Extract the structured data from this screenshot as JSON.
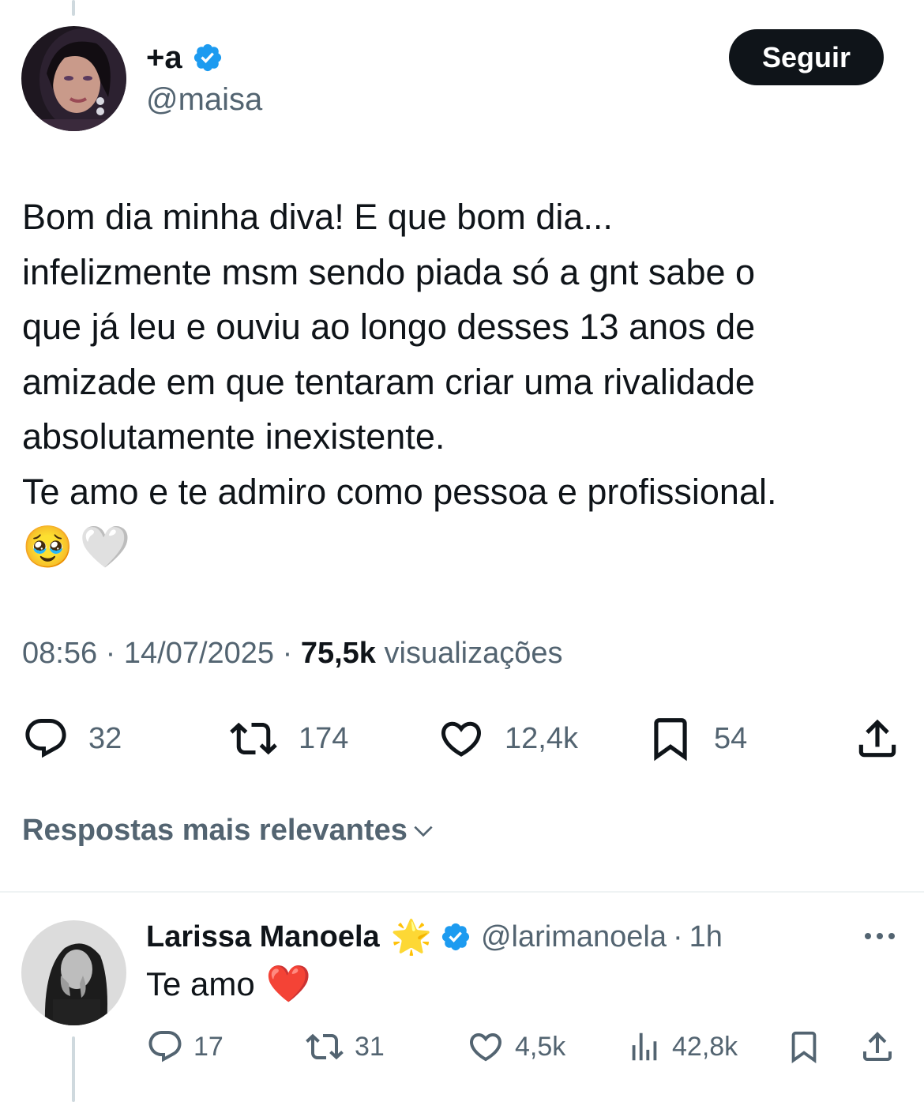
{
  "post": {
    "author_name": "+a",
    "author_handle": "@maisa",
    "follow_label": "Seguir",
    "text": "Bom dia minha diva! E que bom dia...\ninfelizmente msm sendo piada só a gnt sabe o\nque já leu e ouviu ao longo desses 13 anos de\namizade em que tentaram criar uma rivalidade\nabsolutamente inexistente.\nTe amo e te admiro como pessoa e profissional.",
    "emojis": [
      "🥹",
      "🤍"
    ],
    "time": "08:56",
    "separator": "·",
    "date": "14/07/2025",
    "views_count": "75,5k",
    "views_label": "visualizações",
    "replies": "32",
    "reposts": "174",
    "likes": "12,4k",
    "bookmarks": "54"
  },
  "sort": {
    "label": "Respostas mais relevantes"
  },
  "reply": {
    "author_name": "Larissa Manoela",
    "badge_emoji": "🌟",
    "author_handle": "@larimanoela",
    "separator": "·",
    "age": "1h",
    "text": "Te amo",
    "emoji": "❤️",
    "replies": "17",
    "reposts": "31",
    "likes": "4,5k",
    "views": "42,8k"
  },
  "colors": {
    "text": "#0f1419",
    "secondary": "#536471",
    "verified": "#1d9bf0",
    "button_bg": "#0f1419",
    "divider": "#eff3f4"
  },
  "icons": [
    "verified-badge-icon",
    "reply-icon",
    "repost-icon",
    "like-icon",
    "bookmark-icon",
    "share-icon",
    "views-icon",
    "chevron-down-icon",
    "more-icon"
  ]
}
